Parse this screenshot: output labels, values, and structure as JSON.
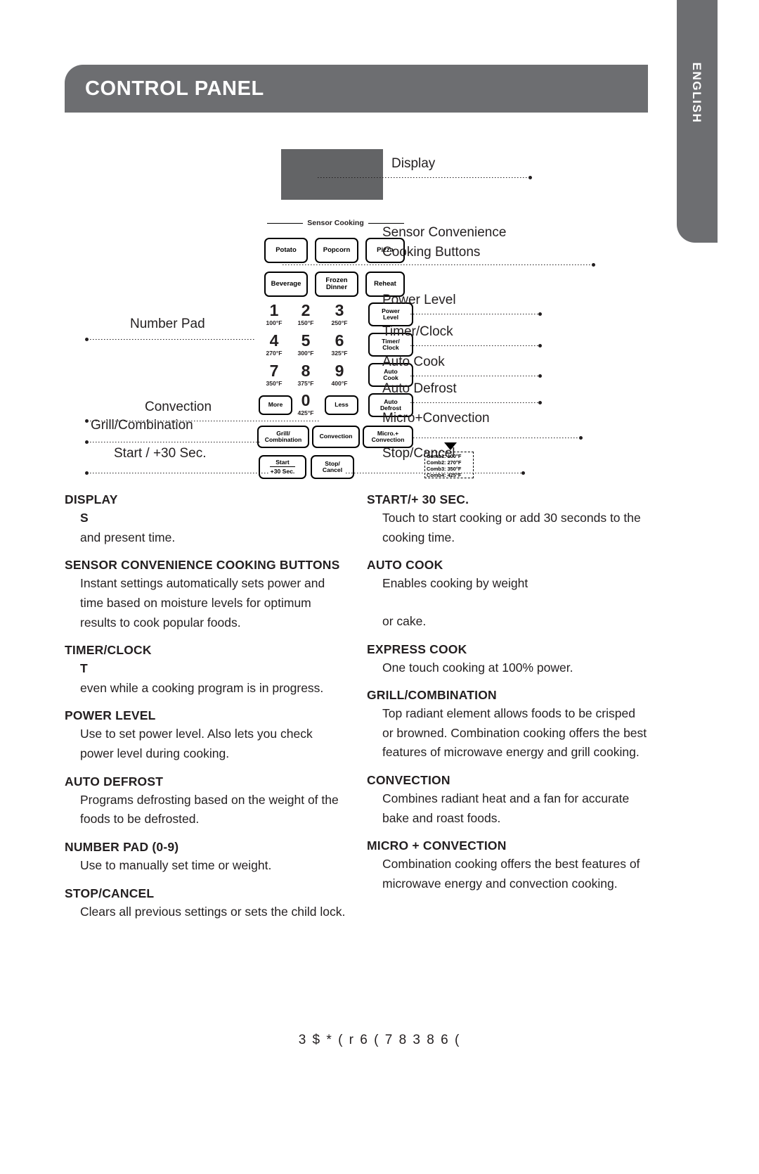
{
  "header": {
    "title": "CONTROL PANEL"
  },
  "side_tab": {
    "label": "ENGLISH"
  },
  "panel": {
    "sensor_cooking_label": "Sensor Cooking",
    "sensor_buttons": [
      {
        "id": "potato",
        "label": "Potato"
      },
      {
        "id": "popcorn",
        "label": "Popcorn"
      },
      {
        "id": "pizza",
        "label": "Pizza"
      },
      {
        "id": "beverage",
        "label": "Beverage"
      },
      {
        "id": "frozen-dinner",
        "label": "Frozen\nDinner"
      },
      {
        "id": "reheat",
        "label": "Reheat"
      }
    ],
    "number_pad": [
      {
        "digit": "1",
        "temp": "100°F"
      },
      {
        "digit": "2",
        "temp": "150°F"
      },
      {
        "digit": "3",
        "temp": "250°F"
      },
      {
        "digit": "4",
        "temp": "270°F"
      },
      {
        "digit": "5",
        "temp": "300°F"
      },
      {
        "digit": "6",
        "temp": "325°F"
      },
      {
        "digit": "7",
        "temp": "350°F"
      },
      {
        "digit": "8",
        "temp": "375°F"
      },
      {
        "digit": "9",
        "temp": "400°F"
      },
      {
        "digit": "0",
        "temp": "425°F"
      }
    ],
    "more_label": "More",
    "less_label": "Less",
    "power_level_key": "Power\nLevel",
    "timer_clock_key": "Timer/\nClock",
    "auto_cook_key": "Auto\nCook",
    "auto_defrost_key": "Auto\nDefrost",
    "grill_combination_key": "Grill/\nCombination",
    "convection_key": "Convection",
    "micro_convection_key": "Micro.+\nConvection",
    "start_key_line1": "Start",
    "start_key_line2": "+30 Sec.",
    "stop_cancel_key": "Stop/\nCancel",
    "comb_box": [
      "Comb1: 100°F",
      "Comb2: 270°F",
      "Comb3: 350°F",
      "Comb4: 425°F"
    ]
  },
  "callouts": {
    "display": "Display",
    "sensor_convenience_l1": "Sensor Convenience",
    "sensor_convenience_l2": "Cooking Buttons",
    "power_level": "Power Level",
    "timer_clock": "Timer/Clock",
    "auto_cook": "Auto Cook",
    "auto_defrost": "Auto Defrost",
    "micro_convection": "Micro+Convection",
    "stop_cancel": "Stop/Cancel",
    "number_pad": "Number Pad",
    "convection": "Convection",
    "grill_combination": "Grill/Combination",
    "start_30sec": "Start / +30 Sec."
  },
  "left_column": [
    {
      "heading": "DISPLAY",
      "orphan": "S",
      "body": "and present time."
    },
    {
      "heading": "SENSOR CONVENIENCE COOKING BUTTONS",
      "body": "Instant settings automatically sets power and time based on moisture levels for optimum results to cook popular foods."
    },
    {
      "heading": "TIMER/CLOCK",
      "orphan": "T",
      "body": "even while a cooking program is in progress."
    },
    {
      "heading": "POWER LEVEL",
      "body": "Use to set power level. Also lets you check power level during cooking."
    },
    {
      "heading": "AUTO DEFROST",
      "body": "Programs defrosting based on the weight of the foods to be defrosted."
    },
    {
      "heading": "NUMBER PAD (0-9)",
      "body": "Use to manually set time or weight."
    },
    {
      "heading": "STOP/CANCEL",
      "body": "Clears all previous settings or sets the child lock."
    }
  ],
  "right_column": [
    {
      "heading": "START/+ 30 SEC.",
      "body": "Touch to start cooking or add 30 seconds to the cooking time."
    },
    {
      "heading": "AUTO COOK",
      "body": "Enables cooking by weight",
      "body2": "or cake."
    },
    {
      "heading": "EXPRESS COOK",
      "body": "One touch cooking at 100% power."
    },
    {
      "heading": "GRILL/COMBINATION",
      "body": "Top radiant element allows foods to be crisped or browned. Combination cooking offers the best features of microwave energy and grill cooking."
    },
    {
      "heading": "CONVECTION",
      "body": "Combines radiant heat and a fan for accurate bake and roast foods."
    },
    {
      "heading": "MICRO + CONVECTION",
      "body": "Combination cooking offers the best features of microwave energy and convection cooking."
    }
  ],
  "footer": {
    "text": "3 $ * (     r  6 ( 7   8 3     8 6 ("
  },
  "colors": {
    "banner": "#6d6e71",
    "display_window": "#636466",
    "text": "#231f20"
  }
}
